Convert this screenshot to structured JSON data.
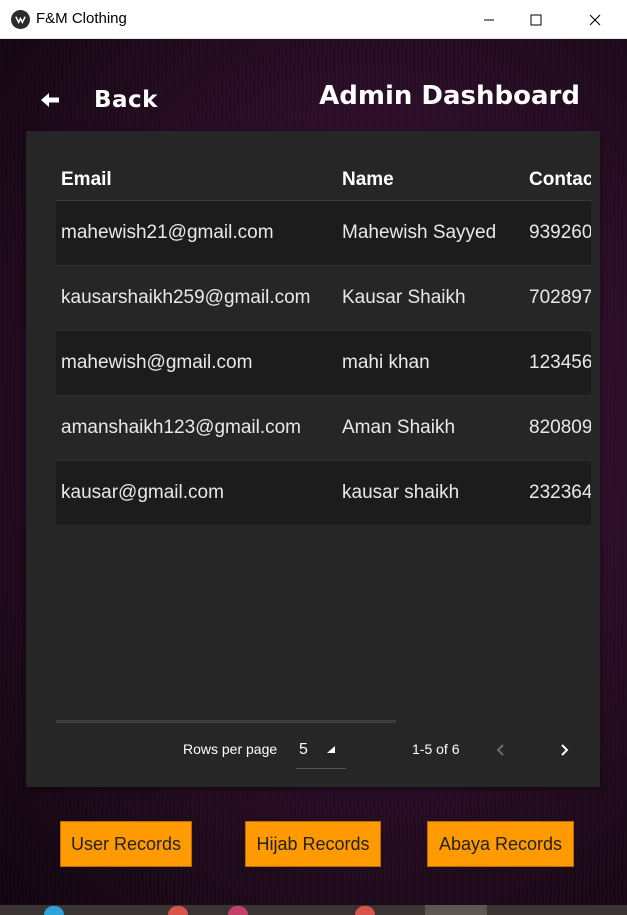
{
  "window": {
    "title": "F&M Clothing"
  },
  "header": {
    "back_label": "Back",
    "title": "Admin Dashboard"
  },
  "table": {
    "columns": [
      "Email",
      "Name",
      "Contac"
    ],
    "rows": [
      [
        "mahewish21@gmail.com",
        "Mahewish Sayyed",
        "939260"
      ],
      [
        "kausarshaikh259@gmail.com",
        "Kausar Shaikh",
        "702897"
      ],
      [
        "mahewish@gmail.com",
        "mahi khan",
        "123456"
      ],
      [
        "amanshaikh123@gmail.com",
        "Aman Shaikh",
        "820809"
      ],
      [
        "kausar@gmail.com",
        "kausar shaikh",
        "232364"
      ]
    ]
  },
  "pagination": {
    "rows_per_page_label": "Rows per page",
    "rows_per_page_value": "5",
    "range_label": "1-5 of 6"
  },
  "buttons": {
    "user_records": "User Records",
    "hijab_records": "Hijab Records",
    "abaya_records": "Abaya Records"
  },
  "colors": {
    "accent": "#ff9a00",
    "card": "#262626",
    "background": "#34102f"
  }
}
